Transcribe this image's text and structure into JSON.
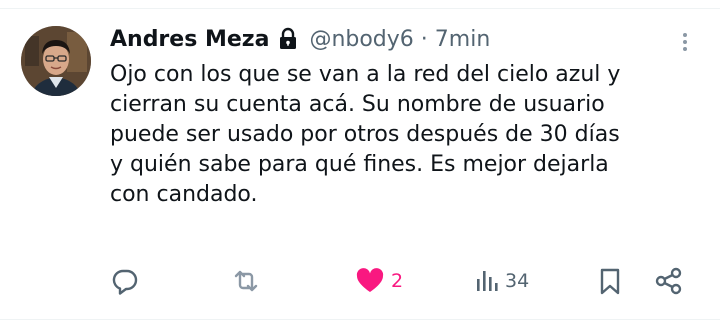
{
  "tweet": {
    "author": {
      "display_name": "Andres Meza",
      "handle": "@nbody6",
      "protected": true
    },
    "separator": "·",
    "time": "7min",
    "text": "Ojo con los que se van a la red del cielo azul y\ncierran su cuenta acá. Su nombre de usuario\npuede ser usado por otros después de 30 días\ny quién sabe para qué fines. Es mejor dejarla\ncon candado.",
    "actions": {
      "reply": {
        "icon": "reply-icon"
      },
      "repost": {
        "icon": "repost-icon"
      },
      "like": {
        "icon": "heart-filled-icon",
        "count": "2",
        "color": "#f91880"
      },
      "views": {
        "icon": "views-icon",
        "count": "34"
      },
      "bookmark": {
        "icon": "bookmark-icon"
      },
      "share": {
        "icon": "share-icon"
      }
    }
  },
  "colors": {
    "text_primary": "#0f1419",
    "text_secondary": "#536471",
    "icon": "#536471",
    "like": "#f91880",
    "divider": "#eff3f4"
  }
}
